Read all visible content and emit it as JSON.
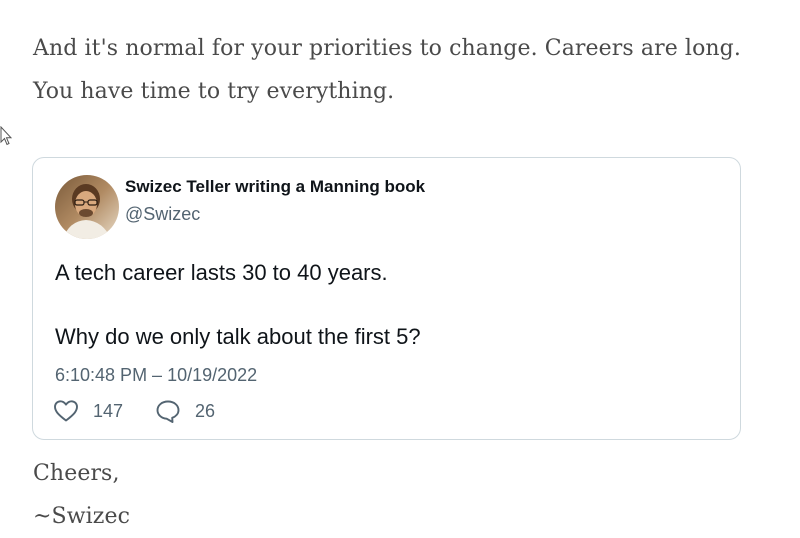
{
  "article": {
    "paragraph": "And it's normal for your priorities to change. Careers are long. You have time to try everything.",
    "closing": "Cheers,",
    "signature": "~Swizec"
  },
  "tweet": {
    "author_name": "Swizec Teller writing a Manning book",
    "author_handle": "@Swizec",
    "text_line_1": "A tech career lasts 30 to 40 years.",
    "text_line_2": "Why do we only talk about the first 5?",
    "timestamp": "6:10:48 PM – 10/19/2022",
    "likes": "147",
    "replies": "26",
    "like_icon": "heart-icon",
    "reply_icon": "speech-bubble-icon"
  },
  "colors": {
    "body_text": "#4a4a4a",
    "tweet_text": "#0f1419",
    "tweet_secondary": "#536471",
    "card_border": "#cfd9de"
  }
}
